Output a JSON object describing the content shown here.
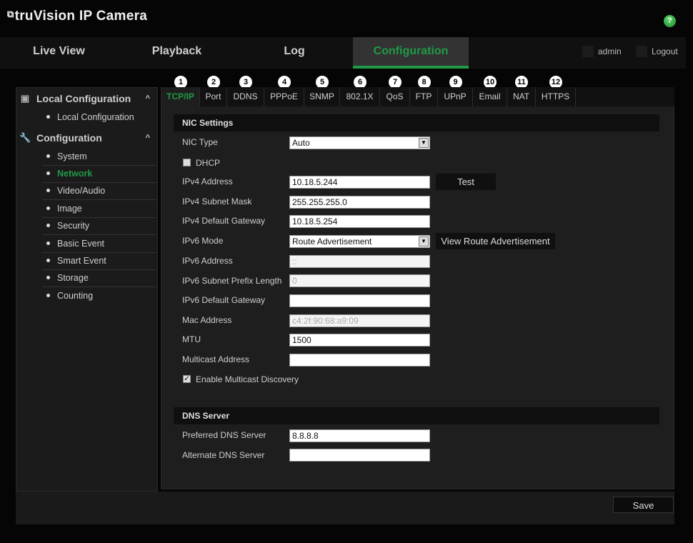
{
  "header": {
    "title": "truVision IP Camera",
    "help_icon": "help-icon",
    "accent_color": "#1f9a46"
  },
  "nav": {
    "tabs": [
      {
        "label": "Live View"
      },
      {
        "label": "Playback"
      },
      {
        "label": "Log"
      },
      {
        "label": "Configuration",
        "active": true
      }
    ],
    "user": "admin",
    "logout": "Logout"
  },
  "sidebar": {
    "sections": [
      {
        "label": "Local Configuration",
        "items": [
          "Local Configuration"
        ]
      },
      {
        "label": "Configuration",
        "items": [
          "System",
          "Network",
          "Video/Audio",
          "Image",
          "Security",
          "Basic Event",
          "Smart Event",
          "Storage",
          "Counting"
        ]
      }
    ],
    "active": "Network"
  },
  "tabs": [
    {
      "num": "1",
      "label": "TCP/IP"
    },
    {
      "num": "2",
      "label": "Port"
    },
    {
      "num": "3",
      "label": "DDNS"
    },
    {
      "num": "4",
      "label": "PPPoE"
    },
    {
      "num": "5",
      "label": "SNMP"
    },
    {
      "num": "6",
      "label": "802.1X"
    },
    {
      "num": "7",
      "label": "QoS"
    },
    {
      "num": "8",
      "label": "FTP"
    },
    {
      "num": "9",
      "label": "UPnP"
    },
    {
      "num": "10",
      "label": "Email"
    },
    {
      "num": "11",
      "label": "NAT"
    },
    {
      "num": "12",
      "label": "HTTPS"
    }
  ],
  "nic": {
    "title": "NIC Settings",
    "nic_type_label": "NIC Type",
    "nic_type": "Auto",
    "dhcp_label": "DHCP",
    "dhcp_checked": false,
    "ipv4_address_label": "IPv4 Address",
    "ipv4_address": "10.18.5.244",
    "test_label": "Test",
    "ipv4_mask_label": "IPv4 Subnet Mask",
    "ipv4_mask": "255.255.255.0",
    "ipv4_gateway_label": "IPv4 Default Gateway",
    "ipv4_gateway": "10.18.5.254",
    "ipv6_mode_label": "IPv6 Mode",
    "ipv6_mode": "Route Advertisement",
    "view_route_label": "View Route Advertisement",
    "ipv6_address_label": "IPv6 Address",
    "ipv6_address": "::",
    "ipv6_prefix_label": "IPv6 Subnet Prefix Length",
    "ipv6_prefix": "0",
    "ipv6_gateway_label": "IPv6 Default Gateway",
    "ipv6_gateway": "",
    "mac_label": "Mac Address",
    "mac": "c4:2f:90:68:a9:09",
    "mtu_label": "MTU",
    "mtu": "1500",
    "multicast_label": "Multicast Address",
    "multicast": "",
    "multicast_discovery_label": "Enable Multicast Discovery",
    "multicast_discovery_checked": true
  },
  "dns": {
    "title": "DNS Server",
    "preferred_label": "Preferred DNS Server",
    "preferred": "8.8.8.8",
    "alternate_label": "Alternate DNS Server",
    "alternate": ""
  },
  "footer": {
    "save_label": "Save"
  }
}
